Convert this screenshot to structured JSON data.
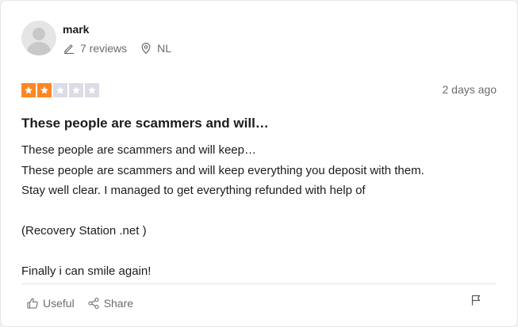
{
  "reviewer": {
    "name": "mark",
    "reviews_count": "7 reviews",
    "country": "NL"
  },
  "review": {
    "rating": 2,
    "max_rating": 5,
    "date": "2 days ago",
    "title": "These people are scammers and will…",
    "body_lines": [
      "These people are scammers and will keep…",
      "These people are scammers and will keep everything you deposit with them.",
      "Stay well clear. I managed to get everything refunded with help of",
      "",
      "(Recovery Station .net )",
      "",
      "Finally i can smile again!"
    ]
  },
  "actions": {
    "useful_label": "Useful",
    "share_label": "Share"
  },
  "colors": {
    "star_filled": "#ff8622",
    "star_empty": "#dcdce6",
    "muted_text": "#6b6b6b"
  },
  "icons": {
    "avatar": "user-silhouette",
    "reviews": "pencil-icon",
    "location": "location-pin-icon",
    "useful": "thumbs-up-icon",
    "share": "share-icon",
    "report": "flag-icon"
  }
}
